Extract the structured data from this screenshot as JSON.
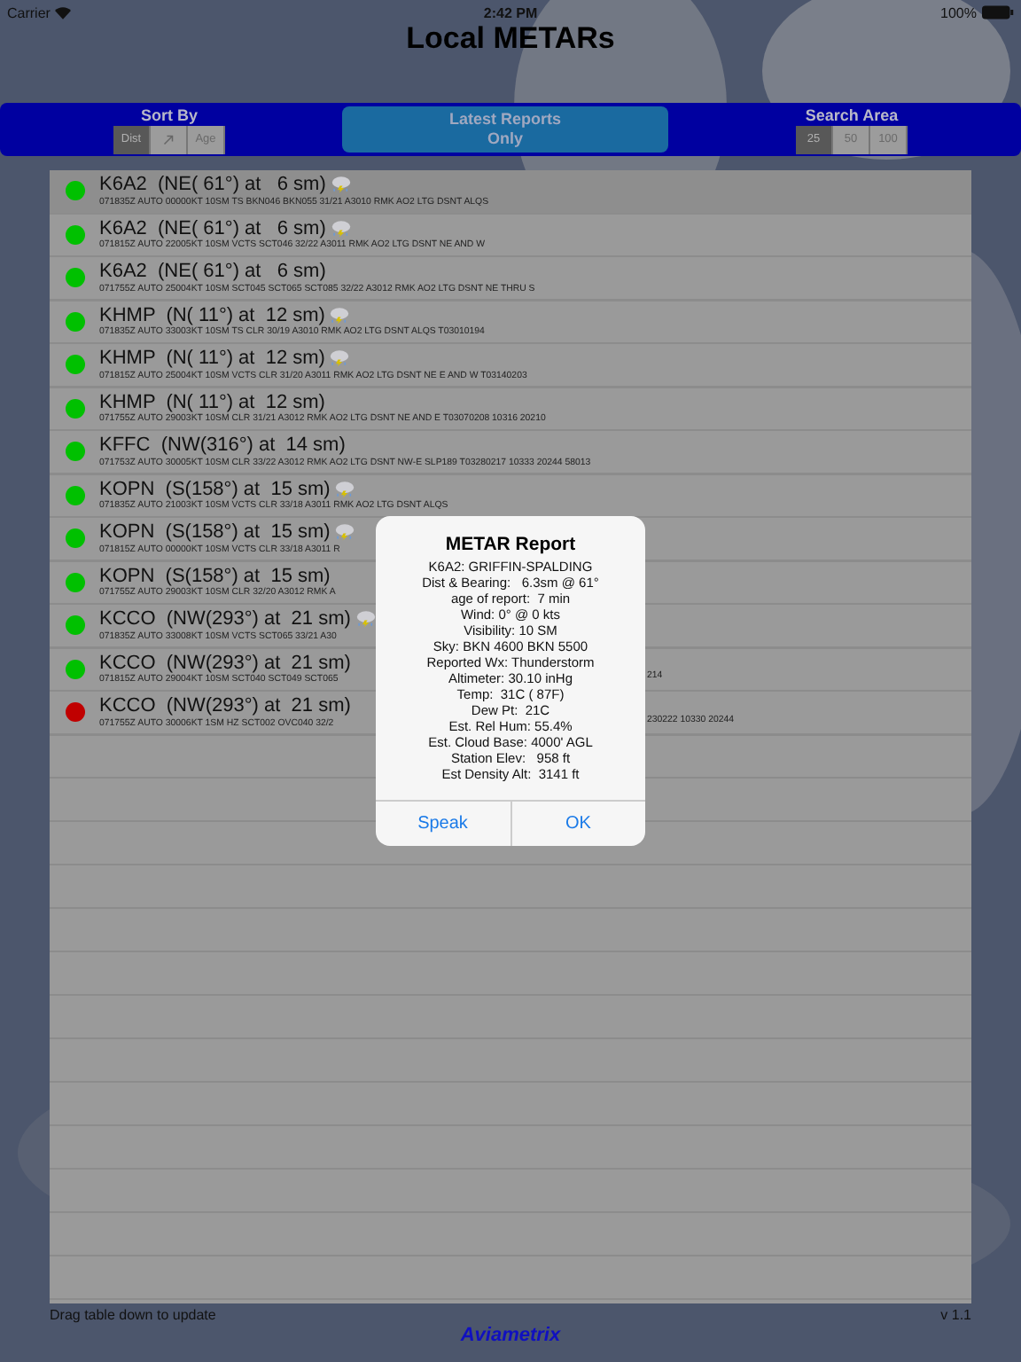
{
  "status_bar": {
    "carrier": "Carrier",
    "time": "2:42 PM",
    "battery": "100%"
  },
  "title": "Local METARs",
  "toolbar": {
    "sort": {
      "label": "Sort By",
      "options": [
        {
          "label": "Dist",
          "kind": "text",
          "selected": true
        },
        {
          "kind": "arrow",
          "selected": false
        },
        {
          "label": "Age",
          "kind": "text",
          "selected": false
        }
      ]
    },
    "latest_button": {
      "lines": [
        "Latest Reports",
        "Only"
      ]
    },
    "area": {
      "label": "Search Area",
      "options": [
        {
          "label": "25",
          "selected": true
        },
        {
          "label": "50",
          "selected": false
        },
        {
          "label": "100",
          "selected": false
        }
      ]
    }
  },
  "reports": [
    {
      "title": "K6A2  (NE( 61°) at   6 sm)",
      "detail": "071835Z AUTO 00000KT 10SM TS BKN046 BKN055 31/21 A3010 RMK AO2 LTG DSNT ALQS",
      "thunderstorm": true,
      "color": "#00c000",
      "selected": true
    },
    {
      "title": "K6A2  (NE( 61°) at   6 sm)",
      "detail": "071815Z AUTO 22005KT 10SM VCTS SCT046 32/22 A3011 RMK AO2 LTG DSNT NE AND W",
      "thunderstorm": true,
      "color": "#00c000",
      "selected": false
    },
    {
      "title": "K6A2  (NE( 61°) at   6 sm)",
      "detail": "071755Z AUTO 25004KT 10SM SCT045 SCT065 SCT085 32/22 A3012 RMK AO2 LTG DSNT NE THRU S",
      "thunderstorm": false,
      "color": "#00c000",
      "selected": false
    },
    {
      "title": "KHMP  (N( 11°) at  12 sm)",
      "detail": "071835Z AUTO 33003KT 10SM TS CLR 30/19 A3010 RMK AO2 LTG DSNT ALQS T03010194",
      "thunderstorm": true,
      "color": "#00c000",
      "selected": false
    },
    {
      "title": "KHMP  (N( 11°) at  12 sm)",
      "detail": "071815Z AUTO 25004KT 10SM VCTS CLR 31/20 A3011 RMK AO2 LTG DSNT NE E AND W T03140203",
      "thunderstorm": true,
      "color": "#00c000",
      "selected": false
    },
    {
      "title": "KHMP  (N( 11°) at  12 sm)",
      "detail": "071755Z AUTO 29003KT 10SM CLR 31/21 A3012 RMK AO2 LTG DSNT NE AND E T03070208 10316 20210",
      "thunderstorm": false,
      "color": "#00c000",
      "selected": false
    },
    {
      "title": "KFFC  (NW(316°) at  14 sm)",
      "detail": "071753Z AUTO 30005KT 10SM CLR 33/22 A3012 RMK AO2 LTG DSNT NW-E SLP189 T03280217 10333 20244 58013",
      "thunderstorm": false,
      "color": "#00c000",
      "selected": false
    },
    {
      "title": "KOPN  (S(158°) at  15 sm)",
      "detail": "071835Z AUTO 21003KT 10SM VCTS CLR 33/18 A3011 RMK AO2 LTG DSNT ALQS",
      "thunderstorm": true,
      "color": "#00c000",
      "selected": false
    },
    {
      "title": "KOPN  (S(158°) at  15 sm)",
      "detail": "071815Z AUTO 00000KT 10SM VCTS CLR 33/18 A3011 R",
      "thunderstorm": true,
      "color": "#00c000",
      "selected": false
    },
    {
      "title": "KOPN  (S(158°) at  15 sm)",
      "detail": "071755Z AUTO 29003KT 10SM CLR 32/20 A3012 RMK A",
      "thunderstorm": false,
      "color": "#00c000",
      "selected": false
    },
    {
      "title": "KCCO  (NW(293°) at  21 sm)",
      "detail": "071835Z AUTO 33008KT 10SM VCTS SCT065 33/21 A30",
      "thunderstorm": true,
      "color": "#00c000",
      "selected": false
    },
    {
      "title": "KCCO  (NW(293°) at  21 sm)",
      "detail": "071815Z AUTO 29004KT 10SM SCT040 SCT049 SCT065",
      "detail_tail": "214",
      "thunderstorm": false,
      "color": "#00c000",
      "selected": false
    },
    {
      "title": "KCCO  (NW(293°) at  21 sm)",
      "detail": "071755Z AUTO 30006KT 1SM HZ SCT002 OVC040 32/2",
      "detail_tail": "230222 10330 20244",
      "thunderstorm": false,
      "color": "#c00000",
      "selected": false
    }
  ],
  "footer": {
    "hint": "Drag table down to update",
    "version": "v 1.1",
    "brand": "Aviametrix"
  },
  "dialog": {
    "title": "METAR Report",
    "lines": [
      "K6A2: GRIFFIN-SPALDING",
      "Dist & Bearing:   6.3sm @ 61°",
      "age of report:  7 min",
      "Wind: 0° @ 0 kts",
      "Visibility: 10 SM",
      "Sky: BKN 4600 BKN 5500",
      "Reported Wx: Thunderstorm",
      "Altimeter: 30.10 inHg",
      "Temp:  31C ( 87F)",
      "Dew Pt:  21C",
      "Est. Rel Hum: 55.4%",
      "Est. Cloud Base: 4000' AGL",
      "Station Elev:   958 ft",
      "Est Density Alt:  3141 ft"
    ],
    "buttons": [
      "Speak",
      "OK"
    ]
  }
}
